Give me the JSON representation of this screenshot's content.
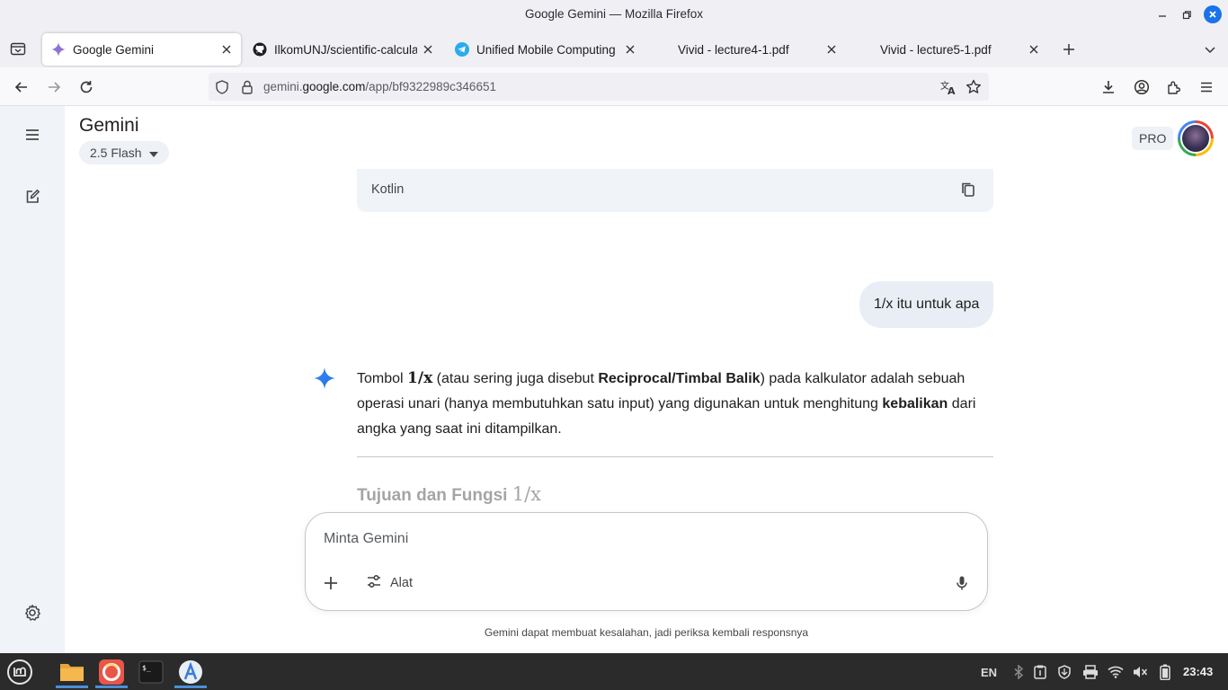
{
  "window": {
    "title": "Google Gemini — Mozilla Firefox"
  },
  "tabs": [
    {
      "label": "Google Gemini",
      "icon": "gemini-icon",
      "active": true
    },
    {
      "label": "IlkomUNJ/scientific-calculat",
      "icon": "github-icon"
    },
    {
      "label": "Unified Mobile Computing C",
      "icon": "telegram-icon"
    },
    {
      "label": "Vivid - lecture4-1.pdf",
      "icon": ""
    },
    {
      "label": "Vivid - lecture5-1.pdf",
      "icon": ""
    }
  ],
  "navbar": {
    "url_prefix": "gemini.",
    "url_domain": "google.com",
    "url_path": "/app/bf9322989c346651"
  },
  "app": {
    "title": "Gemini",
    "model": "2.5 Flash",
    "pro_badge": "PRO"
  },
  "code_block": {
    "language": "Kotlin"
  },
  "conversation": {
    "user_message": "1/x itu untuk apa",
    "reply": {
      "p1_a": "Tombol ",
      "math": "1/x",
      "p1_b": " (atau sering juga disebut ",
      "bold1": "Reciprocal/Timbal Balik",
      "p1_c": ") pada kalkulator adalah sebuah operasi unari (hanya membutuhkan satu input) yang digunakan untuk menghitung ",
      "bold2": "kebalikan",
      "p1_d": " dari angka yang saat ini ditampilkan.",
      "heading_text": "Tujuan dan Fungsi ",
      "heading_math": "1/x"
    }
  },
  "prompt": {
    "placeholder": "Minta Gemini",
    "tools_label": "Alat"
  },
  "disclaimer": "Gemini dapat membuat kesalahan, jadi periksa kembali responsnya",
  "taskbar": {
    "lang": "EN",
    "time": "23:43"
  },
  "colors": {
    "accent": "#1a73e8",
    "sidebar_bg": "#f0f4f9",
    "user_bubble": "#e9eef6",
    "taskbar_bg": "#2b2b2b"
  }
}
